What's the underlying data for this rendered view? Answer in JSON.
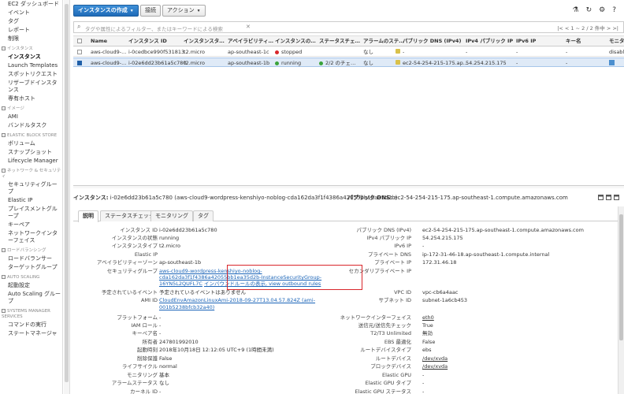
{
  "sidebar": {
    "items": [
      {
        "type": "item",
        "label": "EC2 ダッシュボード"
      },
      {
        "type": "item",
        "label": "イベント"
      },
      {
        "type": "item",
        "label": "タグ"
      },
      {
        "type": "item",
        "label": "レポート"
      },
      {
        "type": "item",
        "label": "制限"
      },
      {
        "type": "section",
        "label": "インスタンス"
      },
      {
        "type": "item",
        "label": "インスタンス",
        "active": true
      },
      {
        "type": "item",
        "label": "Launch Templates"
      },
      {
        "type": "item",
        "label": "スポットリクエスト"
      },
      {
        "type": "item",
        "label": "リザーブドインスタンス",
        "wrap": true
      },
      {
        "type": "item",
        "label": "専有ホスト"
      },
      {
        "type": "section",
        "label": "イメージ"
      },
      {
        "type": "item",
        "label": "AMI"
      },
      {
        "type": "item",
        "label": "バンドルタスク"
      },
      {
        "type": "section",
        "label": "ELASTIC BLOCK STORE"
      },
      {
        "type": "item",
        "label": "ボリューム"
      },
      {
        "type": "item",
        "label": "スナップショット"
      },
      {
        "type": "item",
        "label": "Lifecycle Manager"
      },
      {
        "type": "section",
        "label": "ネットワーク & セキュリティ"
      },
      {
        "type": "item",
        "label": "セキュリティグループ",
        "wrap": true
      },
      {
        "type": "item",
        "label": "Elastic IP"
      },
      {
        "type": "item",
        "label": "プレイスメントグループ",
        "wrap": true
      },
      {
        "type": "item",
        "label": "キーペア"
      },
      {
        "type": "item",
        "label": "ネットワークインターフェイス",
        "wrap": true
      },
      {
        "type": "section",
        "label": "ロードバランシング"
      },
      {
        "type": "item",
        "label": "ロードバランサー"
      },
      {
        "type": "item",
        "label": "ターゲットグループ"
      },
      {
        "type": "section",
        "label": "AUTO SCALING"
      },
      {
        "type": "item",
        "label": "起動設定"
      },
      {
        "type": "item",
        "label": "Auto Scaling グループ",
        "wrap": true
      },
      {
        "type": "section",
        "label": "SYSTEMS MANAGER SERVICES"
      },
      {
        "type": "item",
        "label": "コマンドの実行"
      },
      {
        "type": "item",
        "label": "ステートマネージャ"
      }
    ]
  },
  "toolbar": {
    "launch_label": "インスタンスの作成",
    "connect_label": "接続",
    "actions_label": "アクション"
  },
  "filter": {
    "placeholder": "タグや属性によるフィルター、またはキーワードによる検索",
    "pager": "|<  <  1 ~ 2 / 2 件中  >  >|"
  },
  "grid": {
    "columns": [
      "Name",
      "インスタンス ID",
      "インスタンスタ…",
      "アベイラビリティ…",
      "インスタンスの…",
      "ステータスチェ…",
      "アラームのステ…",
      "パブリック DNS (IPv4)",
      "IPv4 パブリック IP",
      "IPv6 IP",
      "キー名",
      "モニタ"
    ],
    "rows": [
      {
        "name": "aws-cloud9-...",
        "id": "i-0cedbce990f531813",
        "type": "t2.micro",
        "az": "ap-southeast-1c",
        "state": "stopped",
        "state_color": "#d9262b",
        "check": "",
        "alarm": "なし",
        "dns": "-",
        "ipv4": "-",
        "ipv6": "-",
        "key": "-",
        "monitor": "disable",
        "selected": false
      },
      {
        "name": "aws-cloud9-...",
        "id": "i-02e6dd23b61a5c780",
        "type": "t2.micro",
        "az": "ap-southeast-1b",
        "state": "running",
        "state_color": "#3aa33a",
        "check": "2/2 のチェ…",
        "alarm": "なし",
        "dns": "ec2-54-254-215-175.ap...",
        "ipv4": "54.254.215.175",
        "ipv6": "-",
        "key": "-",
        "monitor": "disable",
        "selected": true
      }
    ]
  },
  "detail": {
    "instance_label": "インスタンス:",
    "instance_value": "i-02e6dd23b61a5c780 (aws-cloud9-wordpress-kenshiyo-noblog-cda162da3f1f4386a42055bb1ea35d2b)",
    "dns_label": "パブリック DNS:",
    "dns_value": "ec2-54-254-215-175.ap-southeast-1.compute.amazonaws.com",
    "tabs": [
      "説明",
      "ステータスチェック",
      "モニタリング",
      "タグ"
    ],
    "left": [
      {
        "label": "インスタンス ID",
        "value": "i-02e6dd23b61a5c780"
      },
      {
        "label": "インスタンスの状態",
        "value": "running"
      },
      {
        "label": "インスタンスタイプ",
        "value": "t2.micro"
      },
      {
        "label": "Elastic IP",
        "value": ""
      },
      {
        "label": "アベイラビリティーゾーン",
        "value": "ap-southeast-1b"
      },
      {
        "label": "セキュリティグループ",
        "value": ""
      },
      {
        "label": "予定されているイベント",
        "value": "予定されているイベントはありません"
      },
      {
        "label": "AMI ID",
        "value": ""
      },
      {
        "label": "プラットフォーム",
        "value": "-"
      },
      {
        "label": "IAM ロール",
        "value": "-"
      },
      {
        "label": "キーペア名",
        "value": "-"
      },
      {
        "label": "所有者",
        "value": "247801992010"
      },
      {
        "label": "起動時刻",
        "value": "2018年10月18日 12:12:05 UTC+9 (1時間未満)"
      },
      {
        "label": "削除保護",
        "value": "False"
      },
      {
        "label": "ライフサイクル",
        "value": "normal"
      },
      {
        "label": "モニタリング",
        "value": "基本"
      },
      {
        "label": "アラームステータス",
        "value": "なし"
      },
      {
        "label": "カーネル ID",
        "value": "-"
      }
    ],
    "sg_lines": [
      "aws-cloud9-wordpress-kenshiyo-noblog-",
      "cda162da3f1f4386a42055bb1ea35d2b-InstanceSecurityGroup-",
      "16YN5L2QUFL7C"
    ],
    "sg_rules": "インバウンドルールの表示, view outbound rules",
    "ami_lines": [
      "CloudEnvAmazonLinuxAmi-2018-09-27T13.04.57.824Z (ami-",
      "001b5238bfcb32a40)"
    ],
    "right": [
      {
        "label": "パブリック DNS (IPv4)",
        "value": "ec2-54-254-215-175.ap-southeast-1.compute.amazonaws.com"
      },
      {
        "label": "IPv4 パブリック IP",
        "value": "54.254.215.175"
      },
      {
        "label": "IPv6 IP",
        "value": "-"
      },
      {
        "label": "プライベート DNS",
        "value": "ip-172-31-46-18.ap-southeast-1.compute.internal"
      },
      {
        "label": "プライベート IP",
        "value": "172.31.46.18"
      },
      {
        "label": "セカンダリプライベート IP",
        "value": ""
      },
      {
        "label": "VPC ID",
        "value": "vpc-cb6a4aac"
      },
      {
        "label": "サブネット ID",
        "value": "subnet-1a6cb453"
      },
      {
        "label": "ネットワークインターフェイス",
        "value": "eth0",
        "link": true
      },
      {
        "label": "送信元/送信先チェック",
        "value": "True"
      },
      {
        "label": "T2/T3 Unlimited",
        "value": "無効"
      },
      {
        "label": "EBS 最適化",
        "value": "False"
      },
      {
        "label": "ルートデバイスタイプ",
        "value": "ebs"
      },
      {
        "label": "ルートデバイス",
        "value": "/dev/xvda",
        "link": true
      },
      {
        "label": "ブロックデバイス",
        "value": "/dev/xvda",
        "link": true
      },
      {
        "label": "Elastic GPU",
        "value": "-"
      },
      {
        "label": "Elastic GPU タイプ",
        "value": "-"
      },
      {
        "label": "Elastic GPU ステータス",
        "value": "-"
      }
    ]
  }
}
